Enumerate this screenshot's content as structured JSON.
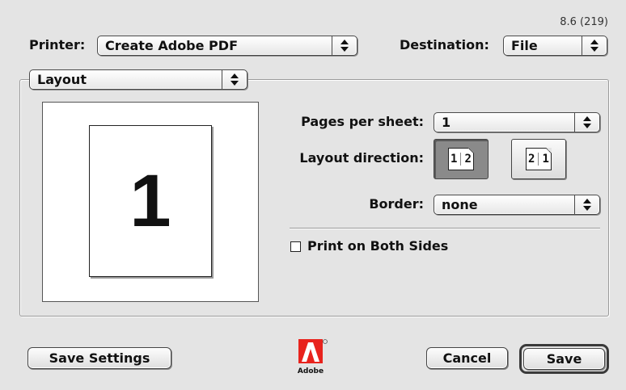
{
  "version": "8.6 (219)",
  "printer": {
    "label": "Printer:",
    "value": "Create Adobe PDF"
  },
  "destination": {
    "label": "Destination:",
    "value": "File"
  },
  "section_menu": {
    "value": "Layout"
  },
  "preview": {
    "page_number": "1"
  },
  "layout": {
    "pages_per_sheet": {
      "label": "Pages per sheet:",
      "value": "1"
    },
    "layout_direction": {
      "label": "Layout direction:",
      "options": [
        {
          "first": "1",
          "second": "2",
          "selected": true
        },
        {
          "first": "2",
          "second": "1",
          "selected": false
        }
      ]
    },
    "border": {
      "label": "Border:",
      "value": "none"
    },
    "print_both_sides": {
      "label": "Print on Both Sides",
      "checked": false
    }
  },
  "footer": {
    "save_settings": "Save Settings",
    "logo_text": "Adobe",
    "cancel": "Cancel",
    "save": "Save"
  },
  "colors": {
    "adobe_red": "#e8231d",
    "background": "#e4e4e4"
  }
}
